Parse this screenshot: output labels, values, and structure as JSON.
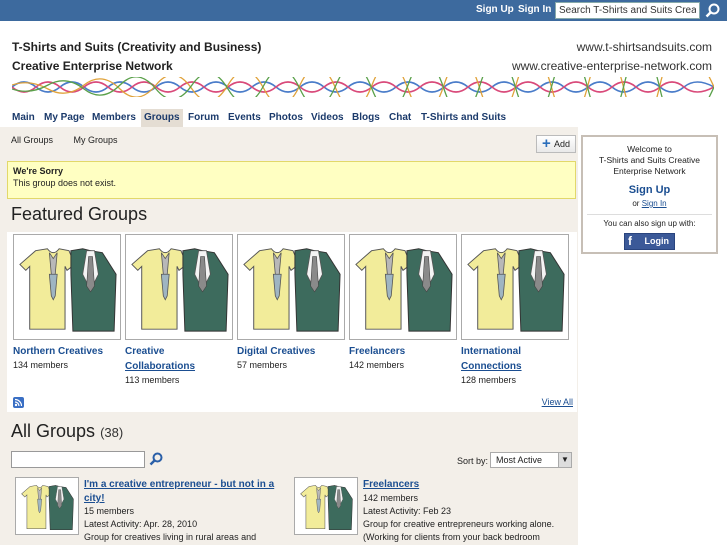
{
  "topbar": {
    "sign_up": "Sign Up",
    "sign_in": "Sign In",
    "search_placeholder": "Search T-Shirts and Suits Creative"
  },
  "header": {
    "title": "T-Shirts and Suits (Creativity and Business)",
    "subtitle": "Creative Enterprise Network",
    "url1": "www.t-shirtsandsuits.com",
    "url2": "www.creative-enterprise-network.com"
  },
  "nav": {
    "tabs": [
      {
        "label": "Main"
      },
      {
        "label": "My Page"
      },
      {
        "label": "Members"
      },
      {
        "label": "Groups"
      },
      {
        "label": "Forum"
      },
      {
        "label": "Events"
      },
      {
        "label": "Photos"
      },
      {
        "label": "Videos"
      },
      {
        "label": "Blogs"
      },
      {
        "label": "Chat"
      },
      {
        "label": "T-Shirts and Suits"
      }
    ]
  },
  "subnav": {
    "all_groups": "All Groups",
    "my_groups": "My Groups",
    "add_label": "Add"
  },
  "notice": {
    "title": "We're Sorry",
    "message": "This group does not exist."
  },
  "featured": {
    "heading": "Featured Groups",
    "view_all": "View All",
    "groups": [
      {
        "name_line1": "Northern Creatives",
        "name_line2": "",
        "members": "134 members"
      },
      {
        "name_line1": "Creative",
        "name_line2": "Collaborations",
        "members": "113 members"
      },
      {
        "name_line1": "Digital Creatives",
        "name_line2": "",
        "members": "57 members"
      },
      {
        "name_line1": "Freelancers",
        "name_line2": "",
        "members": "142 members"
      },
      {
        "name_line1": "International",
        "name_line2": "Connections",
        "members": "128 members"
      }
    ]
  },
  "all_groups": {
    "heading": "All Groups",
    "count": "(38)",
    "sort_label": "Sort by:",
    "sort_value": "Most Active",
    "items": [
      {
        "name_line1": "I'm a creative entrepreneur - but not in a",
        "name_line2": "city!",
        "members": "15 members",
        "activity": "Latest Activity: Apr. 28, 2010",
        "desc": "Group for creatives living in rural areas and"
      },
      {
        "name_line1": "Freelancers",
        "name_line2": "",
        "members": "142 members",
        "activity": "Latest Activity: Feb 23",
        "desc": "Group for creative entrepreneurs working alone.",
        "desc2": "(Working for clients from your back bedroom"
      }
    ]
  },
  "sidebar": {
    "welcome_line1": "Welcome to",
    "welcome_line2": "T-Shirts and Suits Creative",
    "welcome_line3": "Enterprise Network",
    "sign_up": "Sign Up",
    "or": "or",
    "sign_in": "Sign In",
    "also": "You can also sign up with:",
    "fb_login": "Login"
  },
  "colors": {
    "topbar": "#3d6a9e",
    "link": "#1b4e91",
    "content_bg": "#f3efe9",
    "notice_bg": "#ffffc2"
  }
}
